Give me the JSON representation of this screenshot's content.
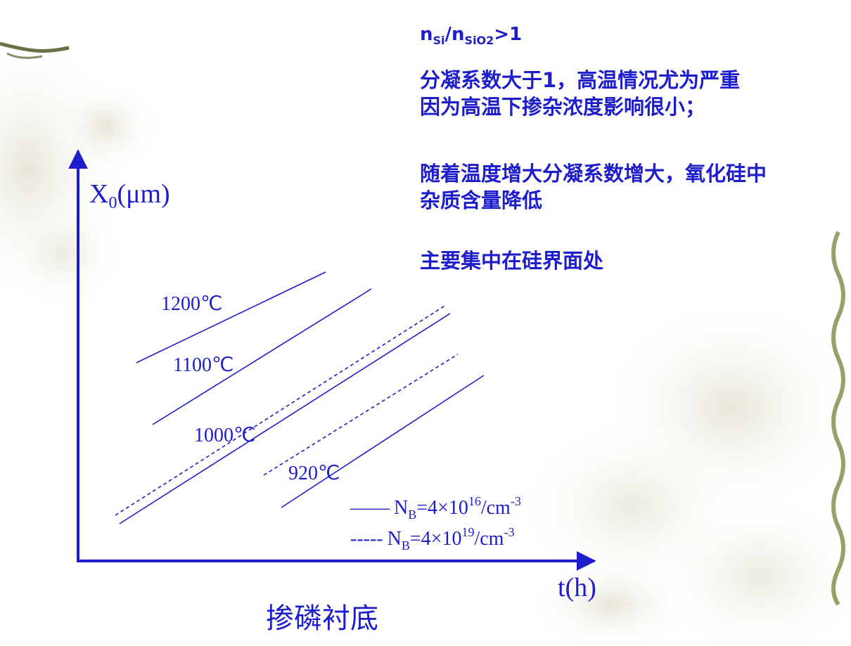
{
  "notes": {
    "formula": {
      "n1": "n",
      "sub1": "Si",
      "slash": "/n",
      "sub2": "SiO2",
      "rest": ">1"
    },
    "line1": "分凝系数大于1，高温情况尤为严重",
    "line2": "因为高温下掺杂浓度影响很小；",
    "line3": "随着温度增大分凝系数增大，氧化硅中",
    "line4": "杂质含量降低",
    "line5": "主要集中在硅界面处"
  },
  "chart_data": {
    "type": "line",
    "y_axis": {
      "symbol": "X",
      "subscript": "0",
      "unit": "(μm)"
    },
    "x_axis": {
      "label": "t(h)"
    },
    "caption": "掺磷衬底",
    "temperatures": [
      "1200℃",
      "1100℃",
      "1000℃",
      "920℃"
    ],
    "legend": [
      {
        "style": "solid",
        "marker": "——",
        "prefix": "N",
        "sub": "B",
        "mid": "=4×10",
        "exp": "16",
        "unit": "/cm",
        "uexp": "-3"
      },
      {
        "style": "dashed",
        "marker": "-----",
        "prefix": "N",
        "sub": "B",
        "mid": "=4×10",
        "exp": "19",
        "unit": "/cm",
        "uexp": "-3"
      }
    ],
    "series": [
      {
        "temperature": "1200℃",
        "style": "solid"
      },
      {
        "temperature": "1100℃",
        "style": "solid"
      },
      {
        "temperature": "1000℃",
        "style": "dashed"
      },
      {
        "temperature": "1000℃",
        "style": "solid"
      },
      {
        "temperature": "920℃",
        "style": "dashed"
      },
      {
        "temperature": "920℃",
        "style": "solid"
      }
    ]
  },
  "colors": {
    "text": "#1d1dcc",
    "axis": "#1d1dcc"
  }
}
